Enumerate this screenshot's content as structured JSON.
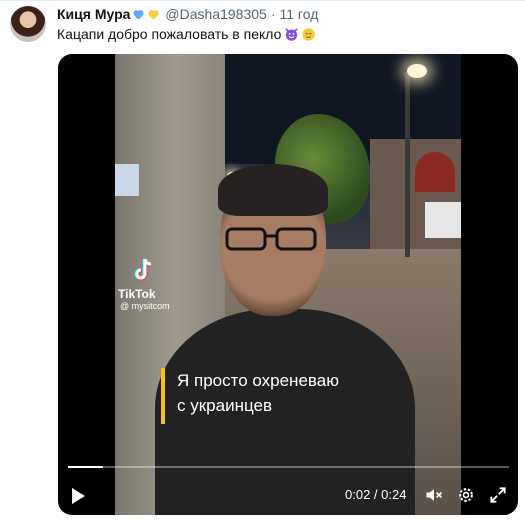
{
  "tweet": {
    "author_name": "Киця Мура",
    "author_emojis": [
      "blue-heart-icon",
      "yellow-heart-icon"
    ],
    "handle": "@Dasha198305",
    "separator": "·",
    "time": "11 год",
    "text": "Кацапи добро пожаловать в пекло",
    "text_emojis": [
      "smiling-imp-icon",
      "relieved-face-icon"
    ]
  },
  "video": {
    "watermark_brand": "TikTok",
    "watermark_user": "@ mysitcom",
    "caption_line1": "Я просто охреневаю",
    "caption_line2": "с украинцев",
    "current_time": "0:02",
    "divider": "/",
    "duration": "0:24",
    "timecode": "0:02 / 0:24",
    "progress": 0.08,
    "caption_bar_color": "#f4c21a"
  },
  "colors": {
    "heart_blue": "#5aa9ff",
    "heart_yellow": "#ffcc3d",
    "imp_purple": "#8a4fd8",
    "relieved_yellow": "#f6c945",
    "secondary_text": "#536471"
  }
}
